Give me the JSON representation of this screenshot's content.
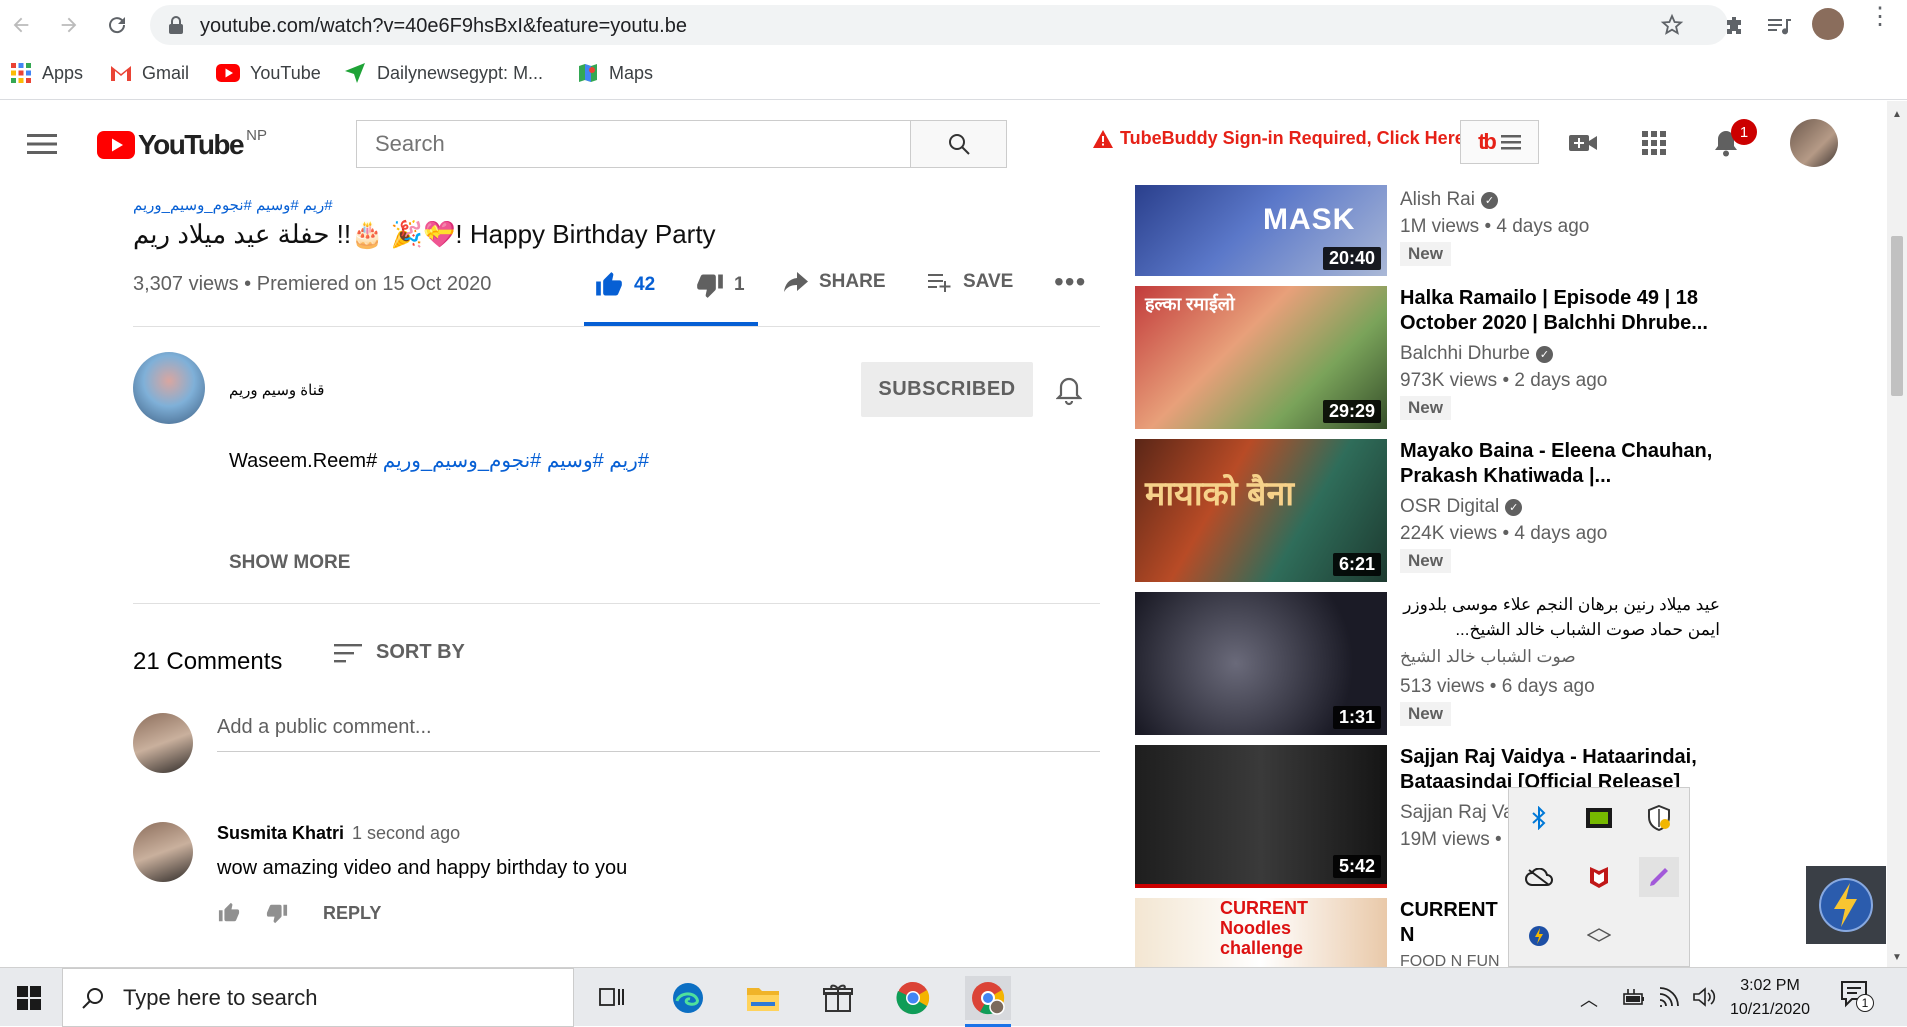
{
  "browser": {
    "url": "youtube.com/watch?v=40e6F9hsBxI&feature=youtu.be",
    "bookmarks": [
      {
        "label": "Apps",
        "icon": "apps-grid-icon"
      },
      {
        "label": "Gmail",
        "icon": "gmail-icon"
      },
      {
        "label": "YouTube",
        "icon": "youtube-icon"
      },
      {
        "label": "Dailynewsegypt: M...",
        "icon": "arrow-icon"
      },
      {
        "label": "Maps",
        "icon": "maps-icon"
      }
    ]
  },
  "header": {
    "logo_text": "YouTube",
    "region": "NP",
    "search_placeholder": "Search",
    "tubebuddy_warning": "TubeBuddy Sign-in Required, Click Here",
    "notification_count": "1"
  },
  "video": {
    "hashtags": "#ريم #وسيم #نجوم_وسيم_وريم",
    "title": "حفلة عيد ميلاد ريم !!🎂 🎉💝! Happy Birthday Party",
    "meta": "3,307 views • Premiered on 15 Oct 2020",
    "likes": "42",
    "dislikes": "1",
    "share_label": "SHARE",
    "save_label": "SAVE",
    "like_ratio": 0.977
  },
  "channel": {
    "name": "قناة وسيم وريم",
    "subscribe_label": "SUBSCRIBED",
    "description_tags": "#ريم #وسيم #نجوم_وسيم_وريم",
    "description_text": "#Waseem.Reem",
    "show_more": "SHOW MORE"
  },
  "comments": {
    "count_label": "21 Comments",
    "sort_label": "SORT BY",
    "input_placeholder": "Add a public comment...",
    "items": [
      {
        "author": "Susmita Khatri",
        "time": "1 second ago",
        "text": "wow amazing video and happy birthday to you",
        "reply_label": "REPLY"
      }
    ]
  },
  "recommendations": [
    {
      "title": "",
      "channel": "Alish Rai",
      "views": "1M views • 4 days ago",
      "badge": "New",
      "duration": "20:40",
      "thumb_text": "MASK"
    },
    {
      "title": "Halka Ramailo | Episode 49 | 18 October 2020 | Balchhi Dhrube...",
      "channel": "Balchhi Dhurbe",
      "views": "973K views • 2 days ago",
      "badge": "New",
      "duration": "29:29",
      "thumb_text": "हल्का रमाईलो"
    },
    {
      "title": "Mayako Baina - Eleena Chauhan, Prakash Khatiwada |...",
      "channel": "OSR Digital",
      "views": "224K views • 4 days ago",
      "badge": "New",
      "duration": "6:21",
      "thumb_text": "मायाको बैना"
    },
    {
      "title": "عيد ميلاد رنين برهان النجم علاء موسى بلدوزر ايمن حماد صوت الشباب خالد الشيخ...",
      "channel": "صوت الشباب خالد الشيخ",
      "views": "513 views • 6 days ago",
      "badge": "New",
      "duration": "1:31",
      "thumb_text": ""
    },
    {
      "title": "Sajjan Raj Vaidya - Hataarindai, Bataasindai [Official Release]",
      "channel": "Sajjan Raj Va",
      "views": "19M views •",
      "badge": "",
      "duration": "5:42",
      "thumb_text": ""
    },
    {
      "title": "CURRENT N Challenge |",
      "channel": "FOOD N FUN",
      "views": "",
      "badge": "",
      "duration": "",
      "thumb_text": "CURRENT Noodles challenge"
    }
  ],
  "taskbar": {
    "search_placeholder": "Type here to search",
    "time": "3:02 PM",
    "date": "10/21/2020",
    "notification_count": "1"
  }
}
